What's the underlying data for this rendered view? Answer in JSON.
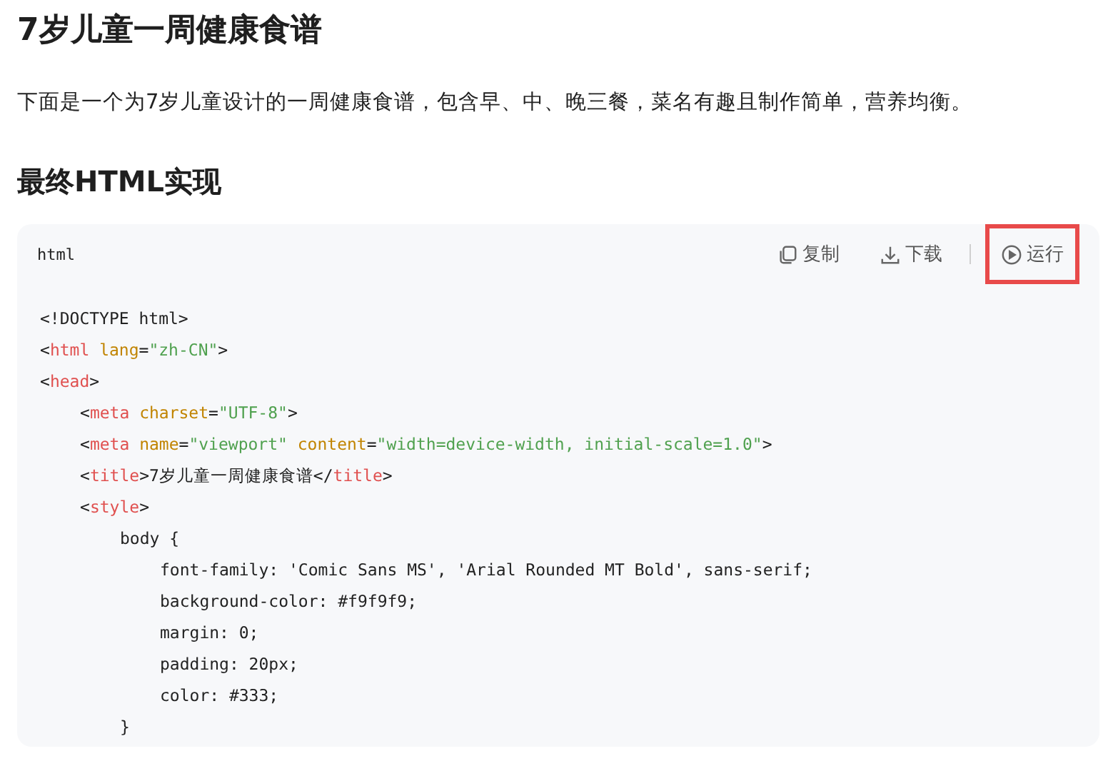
{
  "title": "7岁儿童一周健康食谱",
  "intro": "下面是一个为7岁儿童设计的一周健康食谱，包含早、中、晚三餐，菜名有趣且制作简单，营养均衡。",
  "section_title": "最终HTML实现",
  "code_block": {
    "language": "html",
    "actions": [
      {
        "kind": "copy",
        "label": "复制",
        "highlighted": false
      },
      {
        "kind": "download",
        "label": "下载",
        "highlighted": false
      },
      {
        "kind": "run",
        "label": "运行",
        "highlighted": true
      }
    ],
    "lines": [
      {
        "tokens": [
          {
            "kind": "plain",
            "s": "<!DOCTYPE html>"
          }
        ]
      },
      {
        "tokens": [
          {
            "kind": "plain",
            "s": "<"
          },
          {
            "kind": "tag",
            "s": "html"
          },
          {
            "kind": "attr",
            "s": " lang"
          },
          {
            "kind": "plain",
            "s": "="
          },
          {
            "kind": "string",
            "s": "\"zh-CN\""
          },
          {
            "kind": "plain",
            "s": ">"
          }
        ]
      },
      {
        "tokens": [
          {
            "kind": "plain",
            "s": "<"
          },
          {
            "kind": "tag",
            "s": "head"
          },
          {
            "kind": "plain",
            "s": ">"
          }
        ],
        "children": [
          {
            "tokens": [
              {
                "kind": "plain",
                "s": "<"
              },
              {
                "kind": "tag",
                "s": "meta"
              },
              {
                "kind": "attr",
                "s": " charset"
              },
              {
                "kind": "plain",
                "s": "="
              },
              {
                "kind": "string",
                "s": "\"UTF-8\""
              },
              {
                "kind": "plain",
                "s": ">"
              }
            ]
          },
          {
            "tokens": [
              {
                "kind": "plain",
                "s": "<"
              },
              {
                "kind": "tag",
                "s": "meta"
              },
              {
                "kind": "attr",
                "s": " name"
              },
              {
                "kind": "plain",
                "s": "="
              },
              {
                "kind": "string",
                "s": "\"viewport\""
              },
              {
                "kind": "attr",
                "s": " content"
              },
              {
                "kind": "plain",
                "s": "="
              },
              {
                "kind": "string",
                "s": "\"width=device-width, initial-scale=1.0\""
              },
              {
                "kind": "plain",
                "s": ">"
              }
            ]
          },
          {
            "tokens": [
              {
                "kind": "plain",
                "s": "<"
              },
              {
                "kind": "tag",
                "s": "title"
              },
              {
                "kind": "plain",
                "s": ">7岁儿童一周健康食谱</"
              },
              {
                "kind": "tag",
                "s": "title"
              },
              {
                "kind": "plain",
                "s": ">"
              }
            ]
          },
          {
            "tokens": [
              {
                "kind": "plain",
                "s": "<"
              },
              {
                "kind": "tag",
                "s": "style"
              },
              {
                "kind": "plain",
                "s": ">"
              }
            ],
            "children": [
              {
                "tokens": [
                  {
                    "kind": "plain",
                    "s": "body {"
                  }
                ],
                "children": [
                  {
                    "tokens": [
                      {
                        "kind": "plain",
                        "s": "font-family: 'Comic Sans MS', 'Arial Rounded MT Bold', sans-serif;"
                      }
                    ]
                  },
                  {
                    "tokens": [
                      {
                        "kind": "plain",
                        "s": "background-color: #f9f9f9;"
                      }
                    ]
                  },
                  {
                    "tokens": [
                      {
                        "kind": "plain",
                        "s": "margin: 0;"
                      }
                    ]
                  },
                  {
                    "tokens": [
                      {
                        "kind": "plain",
                        "s": "padding: 20px;"
                      }
                    ]
                  },
                  {
                    "tokens": [
                      {
                        "kind": "plain",
                        "s": "color: #333;"
                      }
                    ]
                  }
                ]
              },
              {
                "tokens": [
                  {
                    "kind": "plain",
                    "s": "}"
                  }
                ]
              }
            ]
          }
        ]
      }
    ]
  }
}
